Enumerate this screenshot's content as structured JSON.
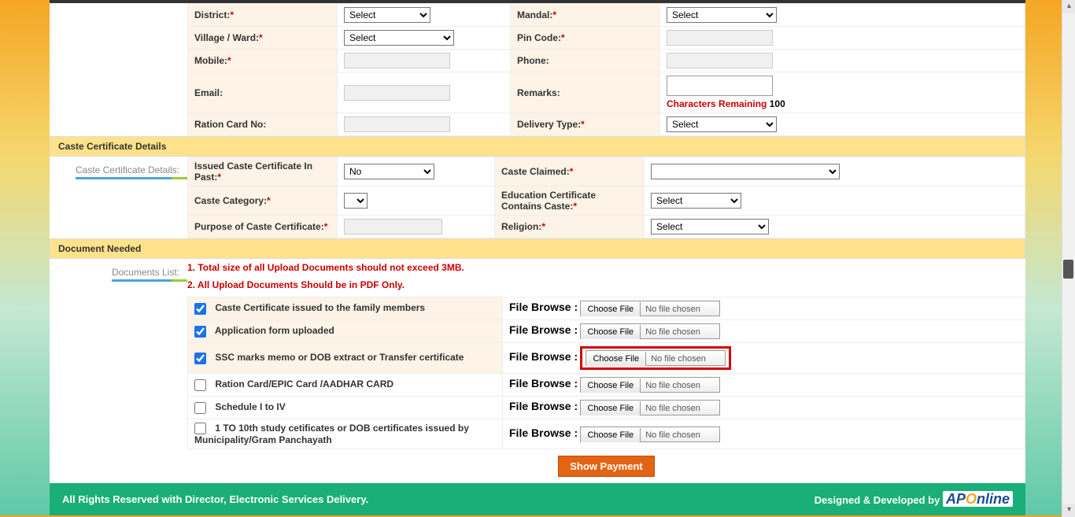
{
  "address": {
    "district_label": "District:",
    "district_value": "Select",
    "mandal_label": "Mandal:",
    "mandal_value": "Select",
    "village_label": "Village / Ward:",
    "village_value": "Select",
    "pincode_label": "Pin Code:",
    "mobile_label": "Mobile:",
    "phone_label": "Phone:",
    "email_label": "Email:",
    "remarks_label": "Remarks:",
    "chars_remaining_label": "Characters Remaining ",
    "chars_remaining_num": "100",
    "ration_label": "Ration Card No:",
    "delivery_label": "Delivery Type:",
    "delivery_value": "Select"
  },
  "caste_section": {
    "header": "Caste Certificate Details",
    "side_label": "Caste Certificate Details:",
    "issued_past_label": "Issued Caste Certificate In Past:",
    "issued_past_value": "No",
    "caste_claimed_label": "Caste Claimed:",
    "caste_category_label": "Caste Category:",
    "edu_cert_label": "Education Certificate Contains Caste:",
    "edu_cert_value": "Select",
    "purpose_label": "Purpose of Caste Certificate:",
    "religion_label": "Religion:",
    "religion_value": "Select"
  },
  "docs_section": {
    "header": "Document Needed",
    "side_label": "Documents List:",
    "note1": "1. Total size of all Upload Documents should not exceed 3MB.",
    "note2": "2. All Upload Documents Should be in PDF Only.",
    "file_browse": "File Browse :",
    "choose_file": "Choose File",
    "no_file": "No file chosen",
    "items": [
      "Caste Certificate issued to the family members",
      "Application form uploaded",
      "SSC marks memo or DOB extract or Transfer certificate",
      "Ration Card/EPIC Card /AADHAR CARD",
      "Schedule I to IV",
      "1 TO 10th study cetificates or DOB certificates issued by Municipality/Gram Panchayath"
    ]
  },
  "show_payment": "Show Payment",
  "footer": {
    "left": "All Rights Reserved with Director, Electronic Services Delivery.",
    "right": "Designed & Developed by ",
    "brand_pre": "AP",
    "brand_o": "O",
    "brand_post": "nline"
  }
}
